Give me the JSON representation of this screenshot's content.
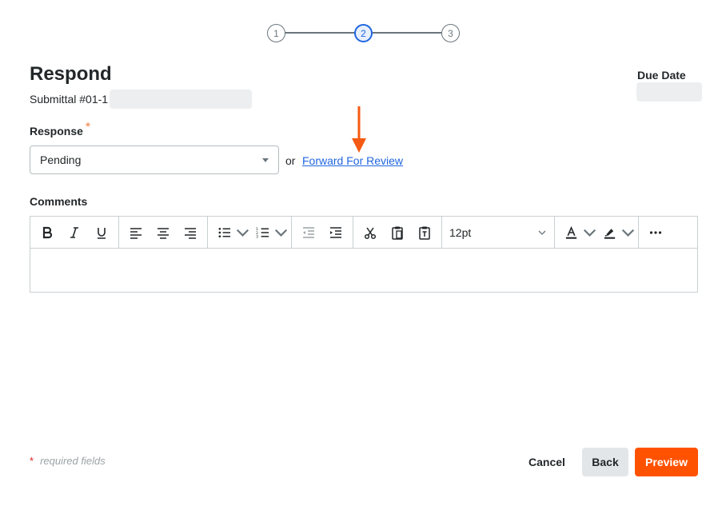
{
  "stepper": {
    "steps": [
      "1",
      "2",
      "3"
    ],
    "active_step": 2
  },
  "header": {
    "title": "Respond",
    "subtitle_prefix": "Submittal #01-1",
    "due_date_label": "Due Date"
  },
  "response": {
    "label": "Response",
    "required_marker": "*",
    "selected_value": "Pending",
    "or_text": "or",
    "forward_link": "Forward For Review"
  },
  "comments": {
    "label": "Comments",
    "toolbar": {
      "font_size": "12pt",
      "icons": [
        "bold-icon",
        "italic-icon",
        "underline-icon",
        "align-left-icon",
        "align-center-icon",
        "align-right-icon",
        "bullet-list-icon",
        "numbered-list-icon",
        "outdent-icon",
        "indent-icon",
        "cut-icon",
        "paste-icon",
        "paste-text-icon",
        "text-color-icon",
        "highlight-icon",
        "more-icon"
      ]
    }
  },
  "footer": {
    "required_star": "*",
    "required_note": "required fields",
    "cancel_label": "Cancel",
    "back_label": "Back",
    "preview_label": "Preview"
  },
  "colors": {
    "accent_orange": "#ff5200",
    "link_blue": "#2066df",
    "annotation_arrow": "#f55a12"
  }
}
